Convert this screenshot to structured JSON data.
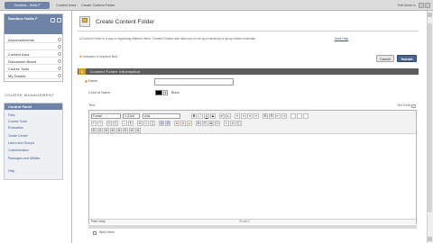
{
  "breadcrumb": {
    "course": "Sandbox - Hollis F",
    "items": [
      "Content Area",
      "Create Content Folder"
    ],
    "separator": "›",
    "right_label": "Edit Mode is"
  },
  "course_menu": {
    "title": "Sandbox Hollis F",
    "items": [
      "Announcements",
      "",
      "Content Area",
      "Discussion Board",
      "Course Tools",
      "My Grades"
    ]
  },
  "management": {
    "section_title": "COURSE MANAGEMENT",
    "control_panel": "Control Panel",
    "items": [
      "Files",
      "Course Tools",
      "Evaluation",
      "Grade Center",
      "Users and Groups",
      "Customization",
      "Packages and Utilities",
      "Help"
    ]
  },
  "page": {
    "title": "Create Content Folder",
    "intro": "A Content Folder is a way of organizing different items. Content Folders also allow you to set up a hierarchy of group related materials.",
    "intro_link": "More Help",
    "required_note": "Indicates a required field.",
    "cancel": "Cancel",
    "submit": "Submit",
    "section_number": "1",
    "section_title": "Content Folder Information",
    "name_label": "Name",
    "color_label": "Color of Name",
    "color_value": "Black",
    "text_label": "Text",
    "text_tools": "Text Editor is",
    "path_label": "Path: body",
    "word_count": "Words:0",
    "spell_label": "Spell check"
  },
  "toolbar": {
    "format": "Format",
    "size": "3 (12pt)",
    "font": "Arial",
    "row1_buttons": [
      "B",
      "I",
      "U",
      "S",
      "x²",
      "x₂",
      "≡",
      "≡",
      "≡",
      "≡",
      "☰",
      "☰",
      "⇤",
      "⇥"
    ],
    "row2_buttons": [
      "↶",
      "↷",
      "⎘",
      "⎗",
      "⌕",
      "¶",
      "Ω",
      "☺",
      "∑",
      "⊞",
      "⊟",
      "⊠",
      "⊡"
    ],
    "row3_buttons": [
      "⊞",
      "⊞",
      "⊞",
      "⊞",
      "⊞",
      "⊞",
      "⊞",
      "⊞"
    ]
  },
  "colors": {
    "menu_header": "#6e83a6",
    "submit": "#49648f",
    "section_bar": "#5d5d5d",
    "accent": "#d7a02d",
    "link": "#3a5a96"
  },
  "icons": [
    "folder-icon",
    "refresh-icon",
    "edit-icon",
    "help-icon",
    "close-icon"
  ]
}
